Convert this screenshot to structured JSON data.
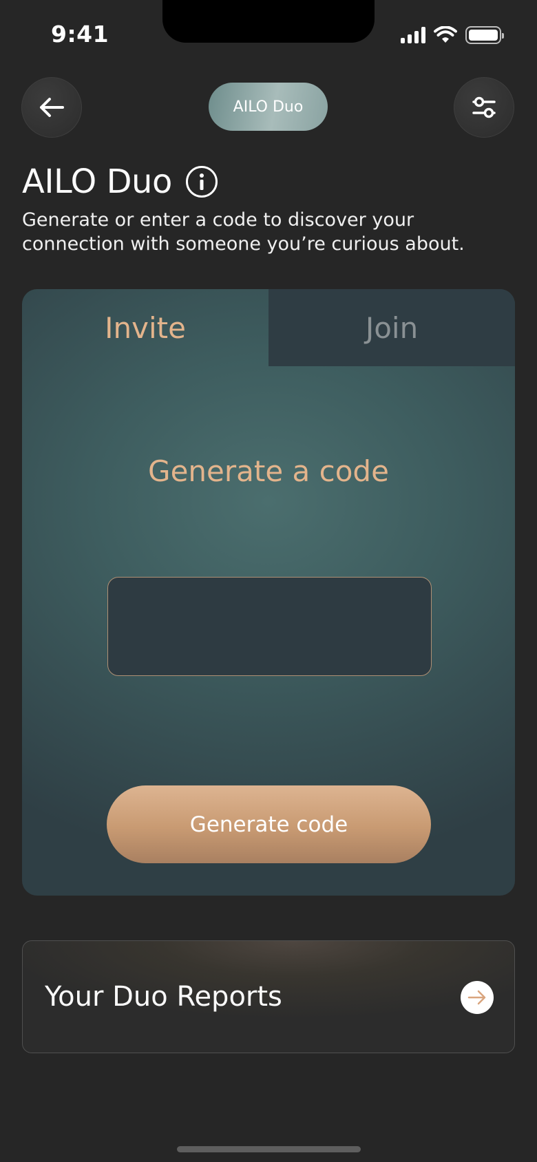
{
  "status": {
    "time": "9:41",
    "icons": [
      "cellular-signal-icon",
      "wifi-icon",
      "battery-icon"
    ]
  },
  "header": {
    "back_icon": "arrow-left-icon",
    "pill_label": "AILO Duo",
    "settings_icon": "sliders-icon"
  },
  "page": {
    "title": "AILO Duo",
    "info_icon": "info-icon",
    "subtitle": "Generate or enter a code to discover your connection with someone you’re curious about."
  },
  "card": {
    "tabs": [
      {
        "label": "Invite",
        "active": true
      },
      {
        "label": "Join",
        "active": false
      }
    ],
    "heading": "Generate a code",
    "code_value": "",
    "button_label": "Generate code"
  },
  "reports": {
    "label": "Your Duo Reports",
    "arrow_icon": "arrow-right-icon"
  },
  "colors": {
    "background": "#262626",
    "accent": "#e3b48c",
    "card_teal": "#4b6e6e",
    "button": "#c89a72"
  }
}
